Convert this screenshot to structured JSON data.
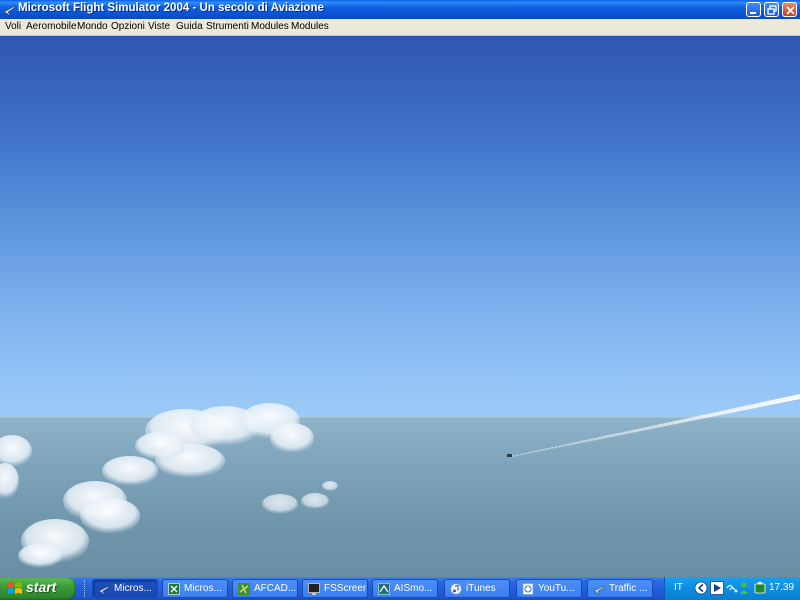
{
  "window": {
    "title": "Microsoft Flight Simulator 2004 - Un secolo di Aviazione",
    "icon": "airplane-icon",
    "controls": [
      "minimize-icon",
      "restore-icon",
      "close-icon"
    ]
  },
  "menu": {
    "items": [
      "Voli",
      "Aeromobile",
      "Mondo",
      "Opzioni",
      "Viste",
      "Guida",
      "Strumenti",
      "Modules",
      "Modules"
    ]
  },
  "scene": {
    "sky_colors": [
      "#2f56b0",
      "#9ccaf7"
    ],
    "sea_color": "#7ea4bb",
    "objects": [
      "clouds",
      "contrail",
      "aircraft"
    ]
  },
  "taskbar": {
    "start_label": "start",
    "buttons": [
      {
        "label": "Micros...",
        "icon": "airplane-icon",
        "active": true
      },
      {
        "label": "Micros...",
        "icon": "excel-icon",
        "active": false
      },
      {
        "label": "AFCAD...",
        "icon": "afcad-icon",
        "active": false
      },
      {
        "label": "FSScreen",
        "icon": "fsscreen-icon",
        "active": false
      },
      {
        "label": "AISmo...",
        "icon": "aismooth-icon",
        "active": false
      },
      {
        "label": "iTunes",
        "icon": "itunes-icon",
        "active": false
      },
      {
        "label": "YouTu...",
        "icon": "youtube-page-icon",
        "active": false
      },
      {
        "label": "Traffic ...",
        "icon": "airplane-icon",
        "active": false
      }
    ],
    "tray": {
      "language": "IT",
      "clock": "17.39",
      "icons": [
        "back-arrow-icon",
        "media-play-icon",
        "network-icon",
        "msn-icon",
        "battery-icon"
      ]
    }
  }
}
